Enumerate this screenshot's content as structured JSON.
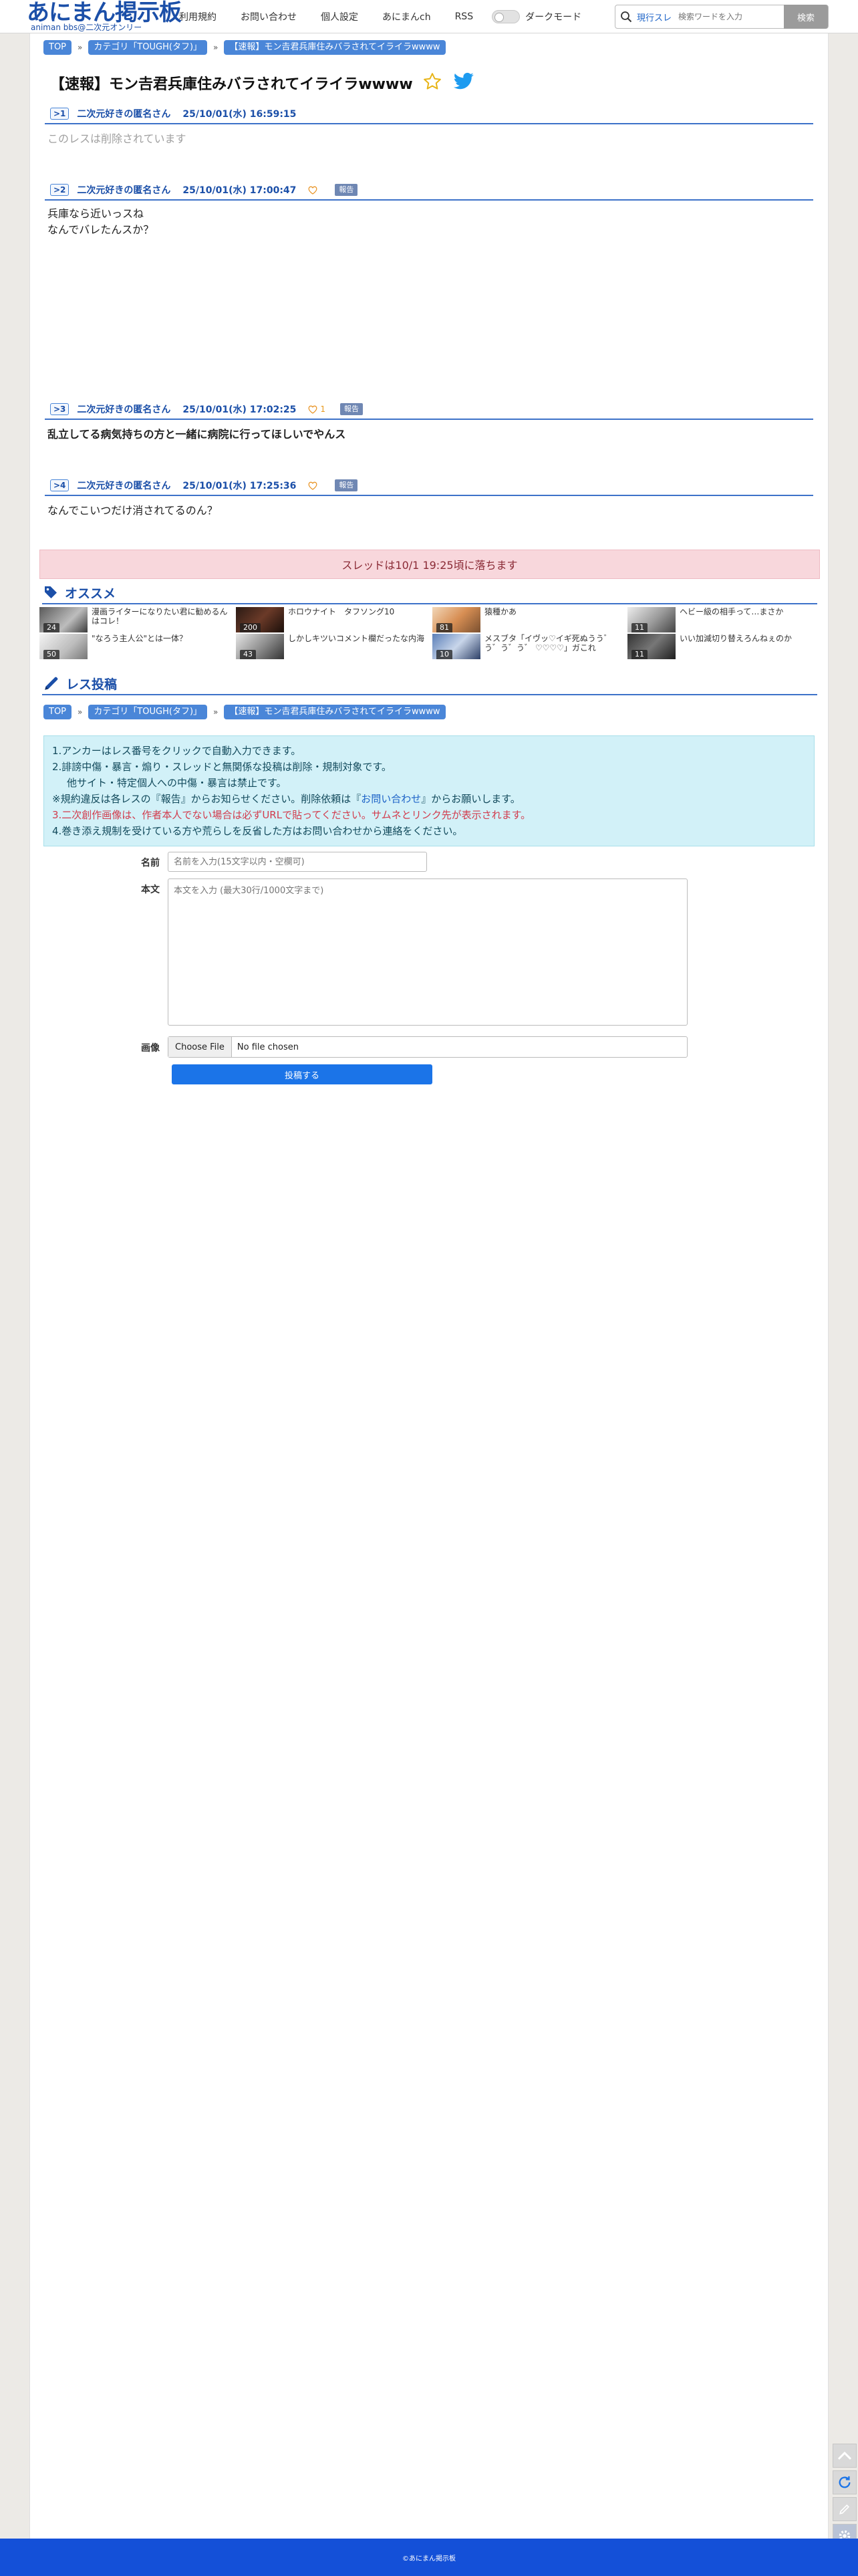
{
  "header": {
    "logo_main": "あにまん掲示板",
    "logo_sub": "animan bbs@二次元オンリー",
    "nav": [
      "利用規約",
      "お問い合わせ",
      "個人設定",
      "あにまんch",
      "RSS"
    ],
    "darkmode_label": "ダークモード",
    "search_scope": "現行スレ",
    "search_placeholder": "検索ワードを入力",
    "search_button": "検索"
  },
  "breadcrumb": {
    "top": "TOP",
    "category": "カテゴリ「TOUGH(タフ)」",
    "thread": "【速報】モン𠮷君兵庫住みバラされてイライラwwww"
  },
  "thread": {
    "title": "【速報】モン𠮷君兵庫住みバラされてイライラwwww"
  },
  "posts": [
    {
      "no": ">1",
      "author": "二次元好きの匿名さん",
      "date": "25/10/01(水) 16:59:15",
      "lines": [
        "このレスは削除されています"
      ]
    },
    {
      "no": ">2",
      "author": "二次元好きの匿名さん",
      "date": "25/10/01(水) 17:00:47",
      "likes": "",
      "report": "報告",
      "lines": [
        "兵庫なら近いっスね",
        "なんでバレたんスか？"
      ]
    },
    {
      "no": ">3",
      "author": "二次元好きの匿名さん",
      "date": "25/10/01(水) 17:02:25",
      "likes": "1",
      "report": "報告",
      "lines": [
        "乱立してる病気持ちの方と一緒に病院に行ってほしいでやんス"
      ]
    },
    {
      "no": ">4",
      "author": "二次元好きの匿名さん",
      "date": "25/10/01(水) 17:25:36",
      "likes": "",
      "report": "報告",
      "lines": [
        "なんでこいつだけ消されてるのん？"
      ]
    }
  ],
  "dropped_notice": "スレッドは10/1 19:25頃に落ちます",
  "recommend": {
    "title": "オススメ",
    "items": [
      {
        "title": "漫画ライターになりたい君に勧めるんはコレ！",
        "count": "24"
      },
      {
        "title": "ホロウナイト　タフソング10",
        "count": "200"
      },
      {
        "title": "猿種かあ",
        "count": "81"
      },
      {
        "title": "ヘビー級の相手って…まさか",
        "count": "11"
      },
      {
        "title": "\"なろう主人公\"とは一体？",
        "count": "50"
      },
      {
        "title": "しかしキツいコメント欄だったな内海",
        "count": "43"
      },
      {
        "title": "メスブタ「イヴッ♡イギ死ぬうう゛う゛う゛う゛ ♡♡♡♡」ガこれ",
        "count": "10"
      },
      {
        "title": "いい加減切り替えろんねぇのか",
        "count": "11"
      }
    ]
  },
  "reply_form": {
    "title": "レス投稿",
    "notice": {
      "line1": "1.アンカーはレス番号をクリックで自動入力できます。",
      "line2": "2.誹謗中傷・暴言・煽り・スレッドと無関係な投稿は削除・規制対象です。",
      "line2b": "他サイト・特定個人への中傷・暴言は禁止です。",
      "line3a": "※規約違反は各レスの『報告』からお知らせください。削除依頼は『",
      "line3link": "お問い合わせ",
      "line3b": "』からお願いします。",
      "line4": "3.二次創作画像は、作者本人でない場合は必ずURLで貼ってください。サムネとリンク先が表示されます。",
      "line5": "4.巻き添え規制を受けている方や荒らしを反省した方はお問い合わせから連絡をください。"
    },
    "name_label": "名前",
    "name_placeholder": "名前を入力(15文字以内・空欄可)",
    "body_label": "本文",
    "body_placeholder": "本文を入力 (最大30行/1000文字まで)",
    "image_label": "画像",
    "file_button": "Choose File",
    "file_status": "No file chosen",
    "submit": "投稿する"
  },
  "footer": {
    "copyright": "©あにまん掲示板"
  }
}
